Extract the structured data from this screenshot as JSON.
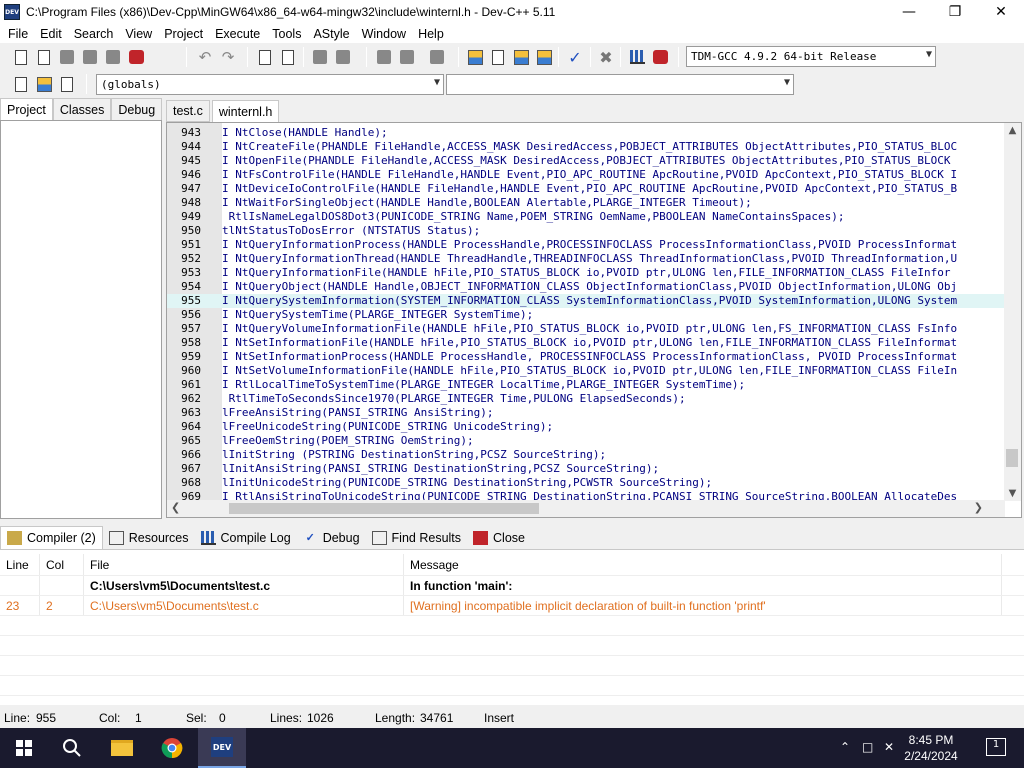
{
  "window": {
    "title": "C:\\Program Files (x86)\\Dev-Cpp\\MinGW64\\x86_64-w64-mingw32\\include\\winternl.h - Dev-C++ 5.11",
    "app_icon_text": "DEV"
  },
  "menu": [
    "File",
    "Edit",
    "Search",
    "View",
    "Project",
    "Execute",
    "Tools",
    "AStyle",
    "Window",
    "Help"
  ],
  "toolbar": {
    "compiler_select": "TDM-GCC 4.9.2 64-bit Release",
    "scope_select": "(globals)",
    "symbol_select": ""
  },
  "left_tabs": [
    {
      "label": "Project",
      "active": true
    },
    {
      "label": "Classes",
      "active": false
    },
    {
      "label": "Debug",
      "active": false
    }
  ],
  "editor_tabs": [
    {
      "label": "test.c",
      "active": false
    },
    {
      "label": "winternl.h",
      "active": true
    }
  ],
  "code_lines": [
    {
      "num": "943",
      "prefix": "",
      "text": "I NtClose(HANDLE Handle);"
    },
    {
      "num": "944",
      "prefix": "",
      "text": "I NtCreateFile(PHANDLE FileHandle,ACCESS_MASK DesiredAccess,POBJECT_ATTRIBUTES ObjectAttributes,PIO_STATUS_BLOC"
    },
    {
      "num": "945",
      "prefix": "",
      "text": "I NtOpenFile(PHANDLE FileHandle,ACCESS_MASK DesiredAccess,POBJECT_ATTRIBUTES ObjectAttributes,PIO_STATUS_BLOCK"
    },
    {
      "num": "946",
      "prefix": "",
      "text": "I NtFsControlFile(HANDLE FileHandle,HANDLE Event,PIO_APC_ROUTINE ApcRoutine,PVOID ApcContext,PIO_STATUS_BLOCK I"
    },
    {
      "num": "947",
      "prefix": "",
      "text": "I NtDeviceIoControlFile(HANDLE FileHandle,HANDLE Event,PIO_APC_ROUTINE ApcRoutine,PVOID ApcContext,PIO_STATUS_B"
    },
    {
      "num": "948",
      "prefix": "",
      "text": "I NtWaitForSingleObject(HANDLE Handle,BOOLEAN Alertable,PLARGE_INTEGER Timeout);"
    },
    {
      "num": "949",
      "prefix": "",
      "text": " RtlIsNameLegalDOS8Dot3(PUNICODE_STRING Name,POEM_STRING OemName,PBOOLEAN NameContainsSpaces);"
    },
    {
      "num": "950",
      "prefix": "",
      "text": "tlNtStatusToDosError (NTSTATUS Status);"
    },
    {
      "num": "951",
      "prefix": "",
      "text": "I NtQueryInformationProcess(HANDLE ProcessHandle,PROCESSINFOCLASS ProcessInformationClass,PVOID ProcessInformat"
    },
    {
      "num": "952",
      "prefix": "",
      "text": "I NtQueryInformationThread(HANDLE ThreadHandle,THREADINFOCLASS ThreadInformationClass,PVOID ThreadInformation,U"
    },
    {
      "num": "953",
      "prefix": "",
      "text": "I NtQueryInformationFile(HANDLE hFile,PIO_STATUS_BLOCK io,PVOID ptr,ULONG len,FILE_INFORMATION_CLASS FileInfor"
    },
    {
      "num": "954",
      "prefix": "",
      "text": "I NtQueryObject(HANDLE Handle,OBJECT_INFORMATION_CLASS ObjectInformationClass,PVOID ObjectInformation,ULONG Obj"
    },
    {
      "num": "955",
      "prefix": "",
      "text": "I NtQuerySystemInformation(SYSTEM_INFORMATION_CLASS SystemInformationClass,PVOID SystemInformation,ULONG System",
      "highlight": true
    },
    {
      "num": "956",
      "prefix": "",
      "text": "I NtQuerySystemTime(PLARGE_INTEGER SystemTime);"
    },
    {
      "num": "957",
      "prefix": "",
      "text": "I NtQueryVolumeInformationFile(HANDLE hFile,PIO_STATUS_BLOCK io,PVOID ptr,ULONG len,FS_INFORMATION_CLASS FsInfo"
    },
    {
      "num": "958",
      "prefix": "",
      "text": "I NtSetInformationFile(HANDLE hFile,PIO_STATUS_BLOCK io,PVOID ptr,ULONG len,FILE_INFORMATION_CLASS FileInformat"
    },
    {
      "num": "959",
      "prefix": "",
      "text": "I NtSetInformationProcess(HANDLE ProcessHandle, PROCESSINFOCLASS ProcessInformationClass, PVOID ProcessInformat"
    },
    {
      "num": "960",
      "prefix": "",
      "text": "I NtSetVolumeInformationFile(HANDLE hFile,PIO_STATUS_BLOCK io,PVOID ptr,ULONG len,FILE_INFORMATION_CLASS FileIn"
    },
    {
      "num": "961",
      "prefix": "",
      "text": "I RtlLocalTimeToSystemTime(PLARGE_INTEGER LocalTime,PLARGE_INTEGER SystemTime);"
    },
    {
      "num": "962",
      "prefix": "",
      "text": " RtlTimeToSecondsSince1970(PLARGE_INTEGER Time,PULONG ElapsedSeconds);"
    },
    {
      "num": "963",
      "prefix": "",
      "text": "lFreeAnsiString(PANSI_STRING AnsiString);"
    },
    {
      "num": "964",
      "prefix": "",
      "text": "lFreeUnicodeString(PUNICODE_STRING UnicodeString);"
    },
    {
      "num": "965",
      "prefix": "",
      "text": "lFreeOemString(POEM_STRING OemString);"
    },
    {
      "num": "966",
      "prefix": "",
      "text": "lInitString (PSTRING DestinationString,PCSZ SourceString);"
    },
    {
      "num": "967",
      "prefix": "",
      "text": "lInitAnsiString(PANSI_STRING DestinationString,PCSZ SourceString);"
    },
    {
      "num": "968",
      "prefix": "",
      "text": "lInitUnicodeString(PUNICODE_STRING DestinationString,PCWSTR SourceString);"
    },
    {
      "num": "969",
      "prefix": "",
      "text": "I RtlAnsiStringToUnicodeString(PUNICODE_STRING DestinationString,PCANSI_STRING SourceString,BOOLEAN AllocateDes"
    }
  ],
  "bottom_tabs": [
    {
      "label": "Compiler (2)",
      "icon": "compiler-icon",
      "active": true
    },
    {
      "label": "Resources",
      "icon": "resources-icon",
      "active": false
    },
    {
      "label": "Compile Log",
      "icon": "compile-log-icon",
      "active": false
    },
    {
      "label": "Debug",
      "icon": "debug-check-icon",
      "active": false
    },
    {
      "label": "Find Results",
      "icon": "find-results-icon",
      "active": false
    },
    {
      "label": "Close",
      "icon": "close-icon",
      "active": false
    }
  ],
  "compiler_table": {
    "headers": [
      "Line",
      "Col",
      "File",
      "Message"
    ],
    "rows": [
      {
        "line": "",
        "col": "",
        "file": "C:\\Users\\vm5\\Documents\\test.c",
        "message": "In function 'main':",
        "style": "bold"
      },
      {
        "line": "23",
        "col": "2",
        "file": "C:\\Users\\vm5\\Documents\\test.c",
        "message": "[Warning] incompatible implicit declaration of built-in function 'printf'",
        "style": "warn"
      }
    ]
  },
  "status": {
    "line_label": "Line:",
    "line_value": "955",
    "col_label": "Col:",
    "col_value": "1",
    "sel_label": "Sel:",
    "sel_value": "0",
    "lines_label": "Lines:",
    "lines_value": "1026",
    "length_label": "Length:",
    "length_value": "34761",
    "mode": "Insert"
  },
  "taskbar": {
    "time": "8:45 PM",
    "date": "2/24/2024",
    "notification_count": "1"
  },
  "colors": {
    "code_text": "#000080",
    "highlight_line": "#e0f5f5",
    "warning": "#e07020",
    "taskbar": "#1a1a2e"
  }
}
